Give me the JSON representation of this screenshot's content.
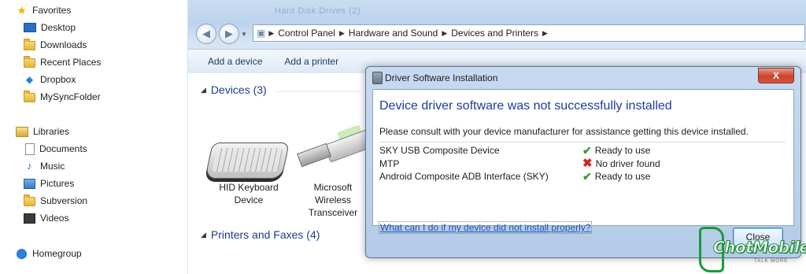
{
  "nav": {
    "favorites": "Favorites",
    "desktop": "Desktop",
    "downloads": "Downloads",
    "recent_places": "Recent Places",
    "dropbox": "Dropbox",
    "mysyncfolder": "MySyncFolder",
    "libraries": "Libraries",
    "documents": "Documents",
    "music": "Music",
    "pictures": "Pictures",
    "subversion": "Subversion",
    "videos": "Videos",
    "homegroup": "Homegroup"
  },
  "explorer": {
    "ghost_title": "Hard Disk Drives (2)",
    "breadcrumb": [
      "Control Panel",
      "Hardware and Sound",
      "Devices and Printers"
    ],
    "toolbar": {
      "add_device": "Add a device",
      "add_printer": "Add a printer"
    },
    "groups": {
      "devices": "Devices (3)",
      "printers": "Printers and Faxes (4)"
    },
    "devices": [
      {
        "line1": "HID Keyboard",
        "line2": "Device",
        "line3": ""
      },
      {
        "line1": "Microsoft",
        "line2": "Wireless",
        "line3": "Transceiver"
      }
    ]
  },
  "dialog": {
    "title": "Driver Software Installation",
    "close_label": "X",
    "heading": "Device driver software was not successfully installed",
    "message": "Please consult with your device manufacturer for assistance getting this device installed.",
    "rows": [
      {
        "name": "SKY USB Composite Device",
        "status": "Ready to use",
        "ok": true
      },
      {
        "name": "MTP",
        "status": "No driver found",
        "ok": false
      },
      {
        "name": "Android Composite ADB Interface (SKY)",
        "status": "Ready to use",
        "ok": true
      }
    ],
    "help_link": "What can I do if my device did not install properly?",
    "button_close": "Close"
  },
  "colors": {
    "heading_blue": "#1e3c9c",
    "ok_green": "#3a9c2f",
    "error_red": "#d3261c",
    "close_red": "#c7432b"
  },
  "watermark": {
    "text": "ChotMobile",
    "sub": "TALK MORE"
  }
}
